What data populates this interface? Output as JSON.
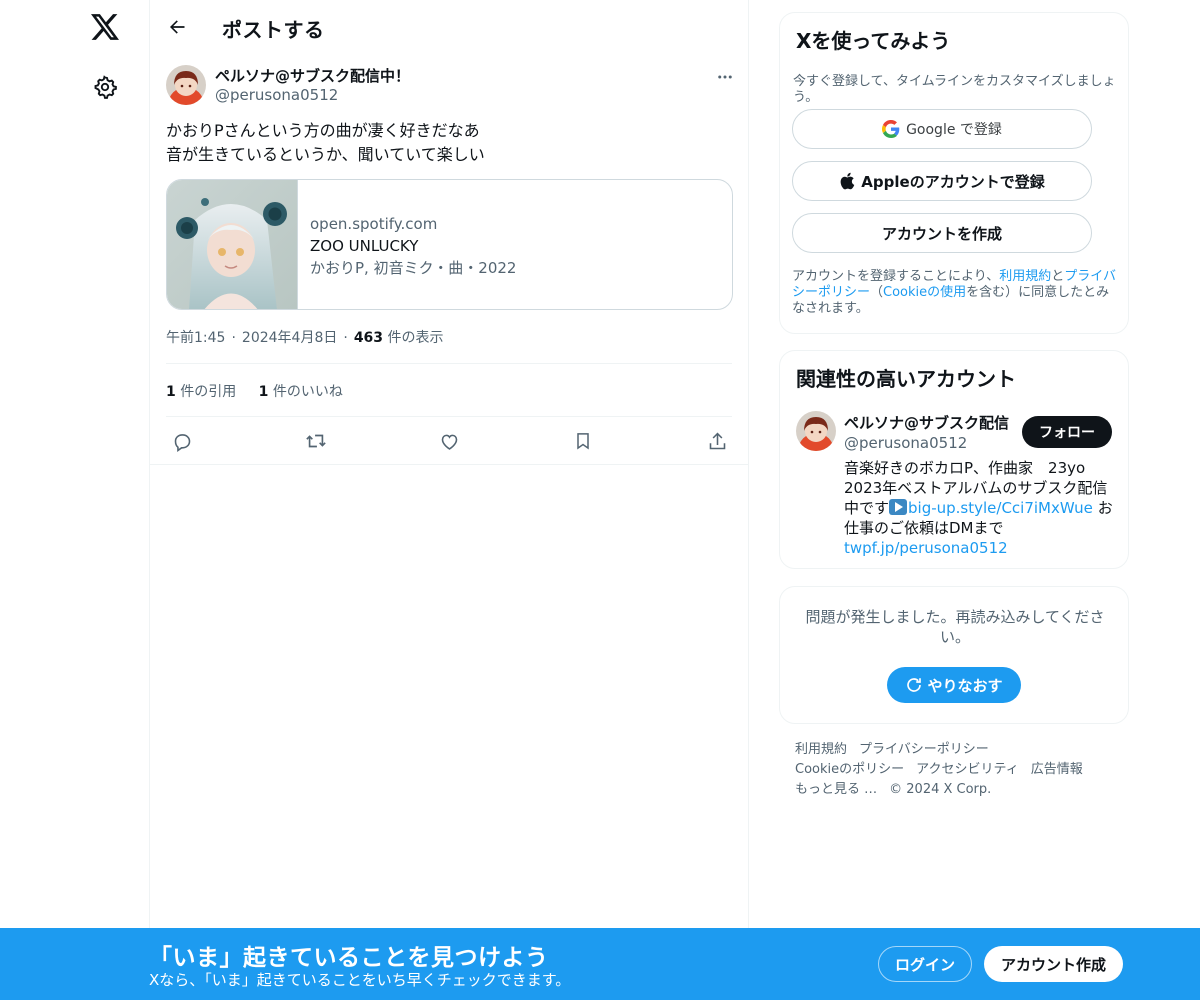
{
  "nav": {
    "logo_icon": "x-logo-icon",
    "settings_icon": "gear-icon"
  },
  "header": {
    "back_icon": "arrow-left-icon",
    "title": "ポストする"
  },
  "post": {
    "author_name": "ペルソナ@サブスク配信中！",
    "author_handle": "@perusona0512",
    "text_lines": [
      "かおりPさんという方の曲が凄く好きだなあ",
      "音が生きているというか、聞いていて楽しい"
    ],
    "card": {
      "domain": "open.spotify.com",
      "title": "ZOO UNLUCKY",
      "description": "かおりP, 初音ミク・曲・2022"
    },
    "meta": {
      "time": "午前1:45",
      "date": "2024年4月8日",
      "views_count": "463",
      "views_label": "件の表示"
    },
    "stats": {
      "quotes_count": "1",
      "quotes_label": "件の引用",
      "likes_count": "1",
      "likes_label": "件のいいね"
    },
    "actions": [
      "reply-icon",
      "repost-icon",
      "like-icon",
      "bookmark-icon",
      "share-icon"
    ]
  },
  "signup": {
    "title": "Xを使ってみよう",
    "subtitle": "今すぐ登録して、タイムラインをカスタマイズしましょう。",
    "google_label": "Google で登録",
    "apple_label": "Appleのアカウントで登録",
    "create_label": "アカウントを作成",
    "terms_prefix": "アカウントを登録することにより、",
    "terms_link": "利用規約",
    "terms_and": "と",
    "privacy_link": "プライバシーポリシー",
    "paren_open": "（",
    "cookie_link": "Cookieの使用",
    "terms_suffix": "を含む）に同意したとみなされます。"
  },
  "related": {
    "title": "関連性の高いアカウント",
    "name": "ペルソナ@サブスク配信",
    "handle": "@perusona0512",
    "follow_label": "フォロー",
    "bio_line1": "音楽好きのボカロP、作曲家　23yo",
    "bio_line2": "2023年ベストアルバムのサブスク配信",
    "bio_line3_prefix": "中です",
    "bio_link1": "big-up.style/Cci7iMxWue",
    "bio_line3_suffix": " お",
    "bio_line4": "仕事のご依頼はDMまで",
    "bio_link2": "twpf.jp/perusona0512"
  },
  "error": {
    "message": "問題が発生しました。再読み込みしてください。",
    "retry_label": "やりなおす"
  },
  "footer": {
    "terms": "利用規約",
    "privacy": "プライバシーポリシー",
    "cookie": "Cookieのポリシー",
    "accessibility": "アクセシビリティ",
    "ads": "広告情報",
    "more": "もっと見る …",
    "copyright": "© 2024 X Corp."
  },
  "banner": {
    "title": "「いま」起きていることを見つけよう",
    "subtitle": "Xなら、「いま」起きていることをいち早くチェックできます。",
    "login_label": "ログイン",
    "create_label": "アカウント作成"
  },
  "colors": {
    "accent": "#1d9bf0",
    "text": "#0f1419",
    "secondary_text": "#536471",
    "border": "#eff3f4"
  }
}
